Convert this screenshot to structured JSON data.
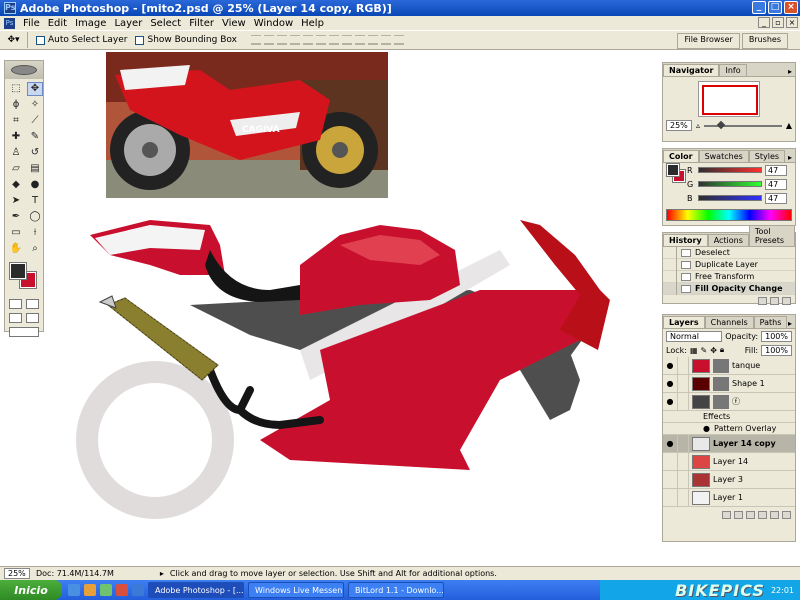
{
  "window": {
    "title": "Adobe Photoshop - [mito2.psd @ 25% (Layer 14 copy, RGB)]",
    "min": "_",
    "max": "□",
    "close": "×"
  },
  "menu": [
    "File",
    "Edit",
    "Image",
    "Layer",
    "Select",
    "Filter",
    "View",
    "Window",
    "Help"
  ],
  "options": {
    "auto_select": "Auto Select Layer",
    "bounding_box": "Show Bounding Box"
  },
  "well": [
    "File Browser",
    "Brushes"
  ],
  "navigator": {
    "tabs": [
      "Navigator",
      "Info"
    ],
    "zoom": "25%"
  },
  "color": {
    "tabs": [
      "Color",
      "Swatches",
      "Styles"
    ],
    "channels": [
      {
        "label": "R",
        "value": "47",
        "color": "#c8102e"
      },
      {
        "label": "G",
        "value": "47",
        "color": "#1a8c1a"
      },
      {
        "label": "B",
        "value": "47",
        "color": "#1a1ab0"
      }
    ]
  },
  "history": {
    "tabs": [
      "History",
      "Actions",
      "Tool Presets"
    ],
    "items": [
      "Deselect",
      "Duplicate Layer",
      "Free Transform",
      "Fill Opacity Change"
    ]
  },
  "layers": {
    "tabs": [
      "Layers",
      "Channels",
      "Paths"
    ],
    "blend_mode": "Normal",
    "opacity_label": "Opacity:",
    "opacity": "100%",
    "lock_label": "Lock:",
    "fill_label": "Fill:",
    "fill": "100%",
    "rows": [
      {
        "name": "tanque",
        "thumb": "#c8102e"
      },
      {
        "name": "Shape 1",
        "thumb": "#5a0000"
      },
      {
        "name": "",
        "thumb": "#444"
      }
    ],
    "effects_label": "Effects",
    "pattern_overlay": "Pattern Overlay",
    "rows2": [
      {
        "name": "Layer 14 copy",
        "active": true
      },
      {
        "name": "Layer 14"
      },
      {
        "name": "Layer 3"
      },
      {
        "name": "Layer 1"
      }
    ]
  },
  "status": {
    "zoom": "25%",
    "doc": "Doc: 71.4M/114.7M",
    "hint": "Click and drag to move layer or selection. Use Shift and Alt for additional options."
  },
  "taskbar": {
    "start": "Inicio",
    "tasks": [
      "Adobe Photoshop - [...",
      "Windows Live Messen...",
      "BitLord 1.1 - Downlo..."
    ],
    "watermark": "BIKEPICS",
    "clock": "22:01"
  },
  "photo_brand": "CAGIVA"
}
